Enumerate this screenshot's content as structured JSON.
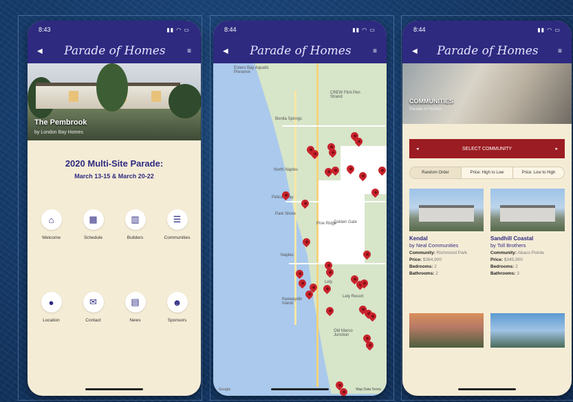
{
  "phone1": {
    "time": "8:43",
    "logo": "Parade of Homes",
    "hero_title": "The Pembrook",
    "hero_subtitle": "by London Bay Homes",
    "parade_title": "2020 Multi-Site Parade:",
    "parade_dates": "March 13-15 & March 20-22",
    "icons": [
      {
        "label": "Welcome",
        "icon": "home-icon"
      },
      {
        "label": "Schedule",
        "icon": "calendar-icon"
      },
      {
        "label": "Builders",
        "icon": "building-icon"
      },
      {
        "label": "Communities",
        "icon": "sign-icon"
      },
      {
        "label": "Location",
        "icon": "map-pin-icon"
      },
      {
        "label": "Contact",
        "icon": "mail-icon"
      },
      {
        "label": "News",
        "icon": "news-icon"
      },
      {
        "label": "Sponsors",
        "icon": "people-icon"
      }
    ]
  },
  "phone2": {
    "time": "8:44",
    "logo": "Parade of Homes",
    "map_labels": [
      "Estero Bay Aquatic Preserve",
      "CREW Flint Pen Strand",
      "Bonita Springs",
      "North Naples",
      "Pelican Bay",
      "Naples",
      "Keewaydin Island",
      "Lely",
      "Lely Resort",
      "Old Marco Junction",
      "Golden Gate",
      "Park Shore",
      "Pine Ridge"
    ],
    "footer_left": "Google",
    "footer_right": "Map Data  Terms"
  },
  "phone3": {
    "time": "8:44",
    "logo": "Parade of Homes",
    "hero_title": "COMMUNITIES",
    "hero_subtitle": "Parade of Homes",
    "select_label": "SELECT COMMUNITY",
    "sort": [
      "Random Order",
      "Price: High to Low",
      "Price: Low to High"
    ],
    "cards": [
      {
        "name": "Kendal",
        "by": "by Neal Communities",
        "community_label": "Community:",
        "community": "Richmond Park",
        "price_label": "Price:",
        "price": "$364,900",
        "bedrooms_label": "Bedrooms:",
        "bedrooms": "2",
        "bathrooms_label": "Bathrooms:",
        "bathrooms": "2"
      },
      {
        "name": "Sandhill Coastal",
        "by": "by Toll Brothers",
        "community_label": "Community:",
        "community": "Abaco Pointe",
        "price_label": "Price:",
        "price": "$345,900",
        "bedrooms_label": "Bedrooms:",
        "bedrooms": "2",
        "bathrooms_label": "Bathrooms:",
        "bathrooms": "3"
      }
    ]
  },
  "colors": {
    "brand_navy": "#2e2a80",
    "accent_red": "#9b1c22",
    "cream": "#f5ecd6"
  }
}
